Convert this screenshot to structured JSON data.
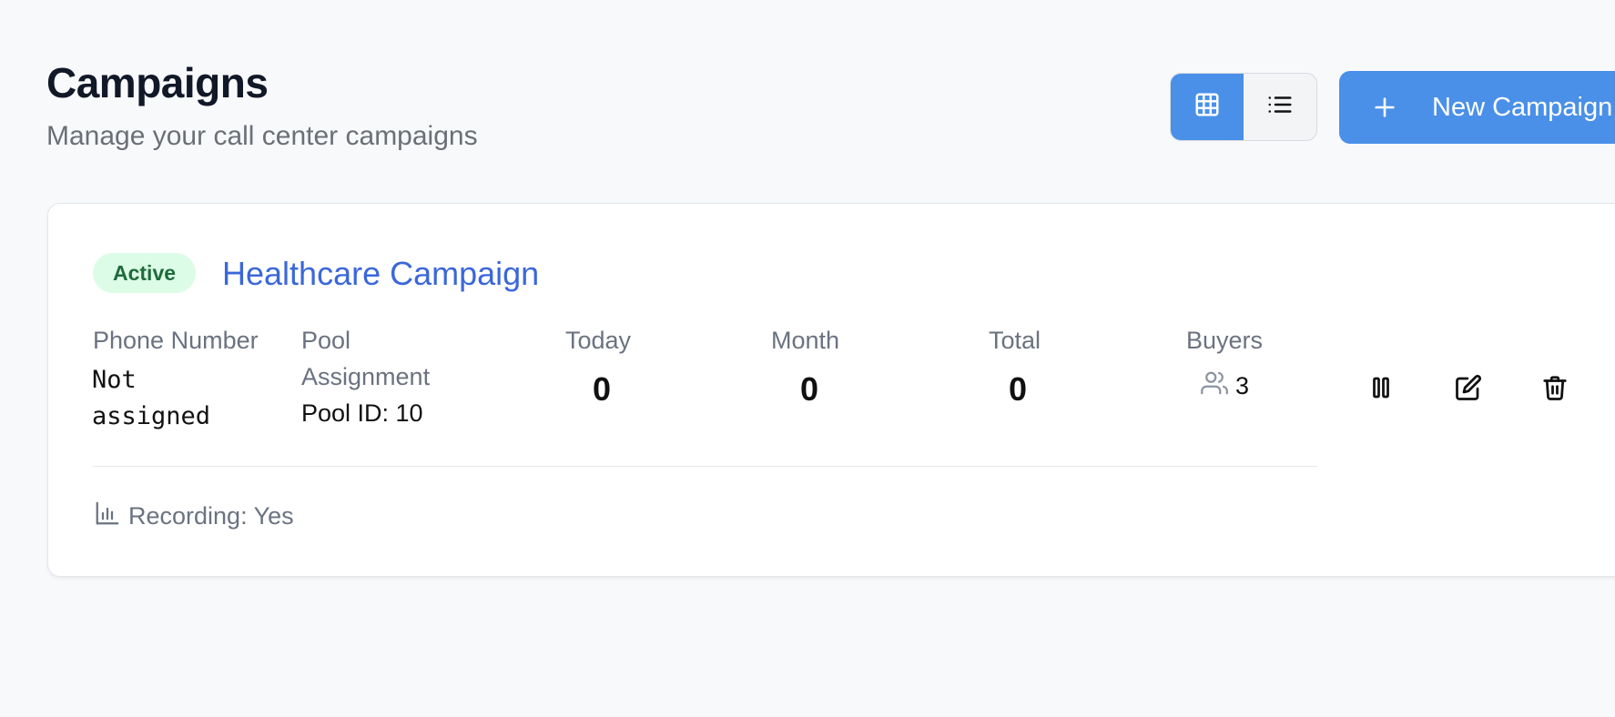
{
  "header": {
    "title": "Campaigns",
    "subtitle": "Manage your call center campaigns",
    "view_toggle": {
      "active": "grid",
      "options": [
        "grid-icon",
        "list-icon"
      ]
    },
    "new_button_label": "New Campaign"
  },
  "campaign": {
    "status": "Active",
    "name": "Healthcare Campaign",
    "phone_number_label": "Phone Number",
    "phone_number_value": "Not assigned",
    "pool_label": "Pool Assignment",
    "pool_value": "Pool ID: 10",
    "stats": [
      {
        "label": "Today",
        "value": "0"
      },
      {
        "label": "Month",
        "value": "0"
      },
      {
        "label": "Total",
        "value": "0"
      }
    ],
    "buyers_label": "Buyers",
    "buyers_count": "3",
    "recording": "Recording: Yes",
    "actions": [
      "pause-icon",
      "edit-icon",
      "trash-icon"
    ]
  },
  "colors": {
    "accent": "#4a90e8",
    "link": "#3b67d9",
    "badge_bg": "#dcfce7",
    "badge_text": "#1f6b3a"
  }
}
